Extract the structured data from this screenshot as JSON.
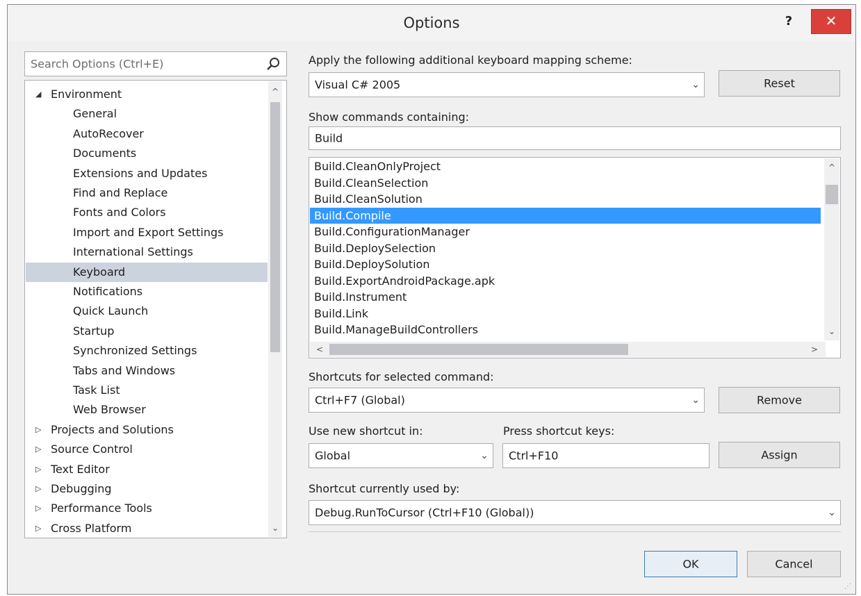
{
  "window": {
    "title": "Options",
    "help_label": "?",
    "close_label": "✕"
  },
  "search": {
    "placeholder": "Search Options (Ctrl+E)"
  },
  "tree": {
    "items": [
      {
        "label": "Environment",
        "level": 0,
        "expanded": true
      },
      {
        "label": "General",
        "level": 1
      },
      {
        "label": "AutoRecover",
        "level": 1
      },
      {
        "label": "Documents",
        "level": 1
      },
      {
        "label": "Extensions and Updates",
        "level": 1
      },
      {
        "label": "Find and Replace",
        "level": 1
      },
      {
        "label": "Fonts and Colors",
        "level": 1
      },
      {
        "label": "Import and Export Settings",
        "level": 1
      },
      {
        "label": "International Settings",
        "level": 1
      },
      {
        "label": "Keyboard",
        "level": 1,
        "selected": true
      },
      {
        "label": "Notifications",
        "level": 1
      },
      {
        "label": "Quick Launch",
        "level": 1
      },
      {
        "label": "Startup",
        "level": 1
      },
      {
        "label": "Synchronized Settings",
        "level": 1
      },
      {
        "label": "Tabs and Windows",
        "level": 1
      },
      {
        "label": "Task List",
        "level": 1
      },
      {
        "label": "Web Browser",
        "level": 1
      },
      {
        "label": "Projects and Solutions",
        "level": 0,
        "expanded": false
      },
      {
        "label": "Source Control",
        "level": 0,
        "expanded": false
      },
      {
        "label": "Text Editor",
        "level": 0,
        "expanded": false
      },
      {
        "label": "Debugging",
        "level": 0,
        "expanded": false
      },
      {
        "label": "Performance Tools",
        "level": 0,
        "expanded": false
      },
      {
        "label": "Cross Platform",
        "level": 0,
        "expanded": false
      }
    ]
  },
  "keyboard": {
    "scheme_label": "Apply the following additional keyboard mapping scheme:",
    "scheme_value": "Visual C# 2005",
    "reset_label": "Reset",
    "show_commands_label": "Show commands containing:",
    "show_commands_value": "Build",
    "commands": [
      {
        "label": "Build.CleanOnlyProject"
      },
      {
        "label": "Build.CleanSelection"
      },
      {
        "label": "Build.CleanSolution"
      },
      {
        "label": "Build.Compile",
        "selected": true
      },
      {
        "label": "Build.ConfigurationManager"
      },
      {
        "label": "Build.DeploySelection"
      },
      {
        "label": "Build.DeploySolution"
      },
      {
        "label": "Build.ExportAndroidPackage.apk"
      },
      {
        "label": "Build.Instrument"
      },
      {
        "label": "Build.Link"
      },
      {
        "label": "Build.ManageBuildControllers"
      }
    ],
    "shortcuts_label": "Shortcuts for selected command:",
    "shortcuts_value": "Ctrl+F7 (Global)",
    "remove_label": "Remove",
    "use_in_label": "Use new shortcut in:",
    "use_in_value": "Global",
    "press_keys_label": "Press shortcut keys:",
    "press_keys_value": "Ctrl+F10",
    "assign_label": "Assign",
    "used_by_label": "Shortcut currently used by:",
    "used_by_value": "Debug.RunToCursor (Ctrl+F10 (Global))"
  },
  "footer": {
    "ok_label": "OK",
    "cancel_label": "Cancel"
  },
  "icons": {
    "expanded": "◢",
    "collapsed": "▷",
    "dropdown": "⌄",
    "scroll_up": "^",
    "scroll_down": "⌄",
    "scroll_left": "<",
    "scroll_right": ">"
  },
  "colors": {
    "selection_blue": "#3399ff",
    "tree_selection": "#ccd2de",
    "close_red": "#d9403a"
  }
}
